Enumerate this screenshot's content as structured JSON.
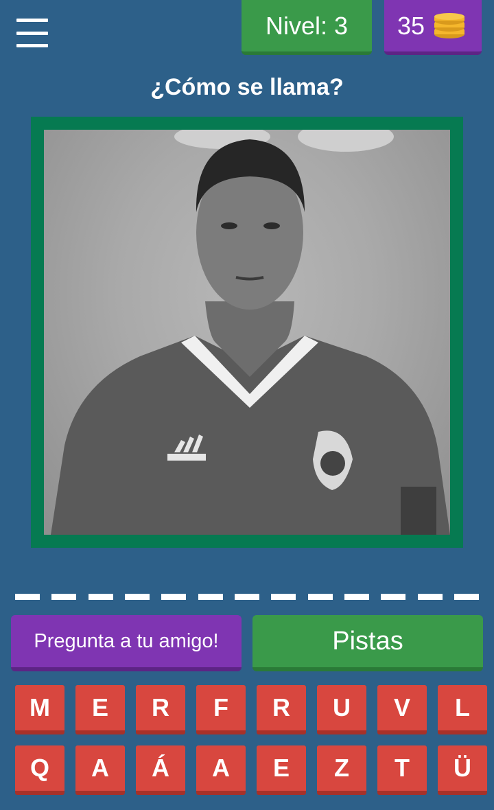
{
  "header": {
    "menu_icon": "hamburger-menu-icon",
    "level_label": "Nivel: 3",
    "coins_count": "35",
    "coins_icon": "coin-stack-icon"
  },
  "question": "¿Cómo se llama?",
  "photo": {
    "description_icon": "player-photo",
    "frame_color": "#067a51"
  },
  "answer": {
    "slot_count": 13
  },
  "buttons": {
    "ask_friend": "Pregunta a tu amigo!",
    "hints": "Pistas"
  },
  "keys": [
    "M",
    "E",
    "R",
    "F",
    "R",
    "U",
    "V",
    "L",
    "Q",
    "A",
    "Á",
    "A",
    "E",
    "Z",
    "T",
    "Ü"
  ],
  "colors": {
    "background": "#2d6089",
    "green": "#3a9a4a",
    "purple": "#7f35b2",
    "key_red": "#d8473f",
    "coin_gold": "#f5b72c"
  }
}
